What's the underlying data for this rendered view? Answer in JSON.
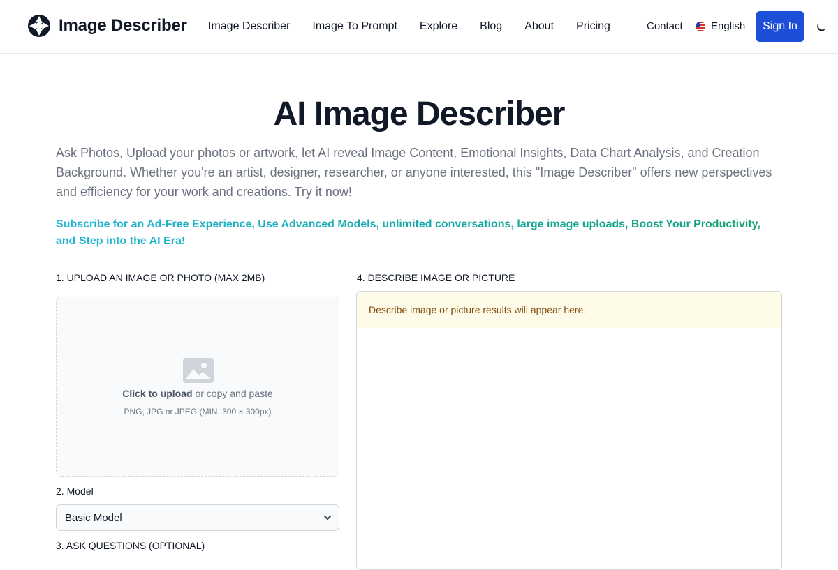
{
  "header": {
    "brand": "Image Describer",
    "nav": [
      "Image Describer",
      "Image To Prompt",
      "Explore",
      "Blog",
      "About",
      "Pricing"
    ],
    "contact": "Contact",
    "language": "English",
    "signin": "Sign In",
    "icons": {
      "logo": "aperture-logo-icon",
      "flag": "us-flag-icon",
      "theme": "moon-icon"
    }
  },
  "hero": {
    "title": "AI Image Describer",
    "subtitle": "Ask Photos, Upload your photos or artwork, let AI reveal Image Content, Emotional Insights, Data Chart Analysis, and Creation Background. Whether you're an artist, designer, researcher, or anyone interested, this \"Image Describer\" offers new perspectives and efficiency for your work and creations. Try it now!",
    "promo": "Subscribe for an Ad-Free Experience, Use Advanced Models, unlimited conversations, large image uploads, Boost Your Productivity, and Step into the AI Era!"
  },
  "upload": {
    "label": "1. UPLOAD AN IMAGE OR PHOTO (MAX 2MB)",
    "cta_bold": "Click to upload",
    "cta_rest": " or copy and paste",
    "hint": "PNG, JPG or JPEG (MIN. 300 × 300px)",
    "icon": "image-placeholder-icon"
  },
  "model": {
    "label": "2. Model",
    "selected": "Basic Model",
    "icon": "chevron-down-icon"
  },
  "questions": {
    "label": "3. ASK QUESTIONS (OPTIONAL)"
  },
  "result": {
    "label": "4. DESCRIBE IMAGE OR PICTURE",
    "placeholder": "Describe image or picture results will appear here."
  },
  "colors": {
    "accent": "#1d4ed8",
    "promo_start": "#22b5d6",
    "promo_end": "#0f9f6e",
    "banner_bg": "#fefce8",
    "banner_text": "#854d0e"
  }
}
